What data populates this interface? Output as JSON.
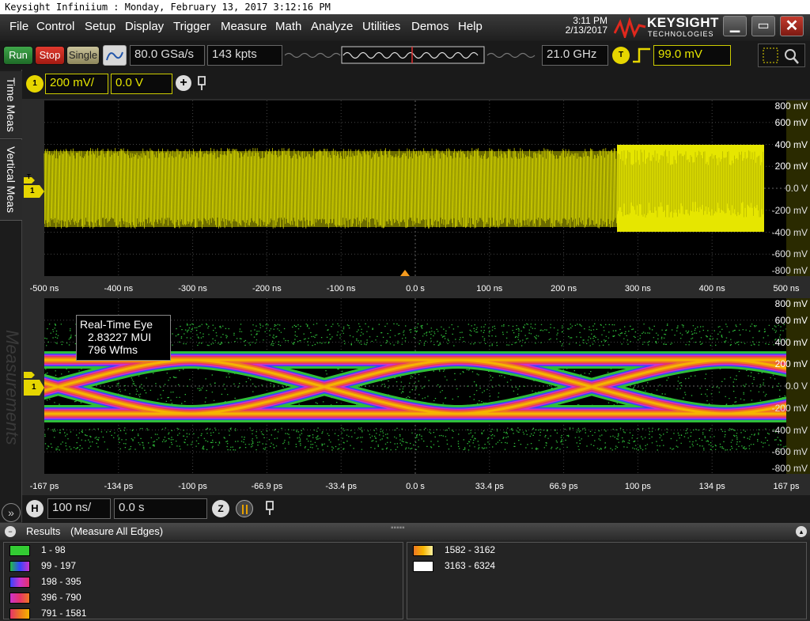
{
  "window": {
    "title": "Keysight Infiniium : Monday, February 13, 2017 3:12:16 PM"
  },
  "menu": [
    "File",
    "Control",
    "Setup",
    "Display",
    "Trigger",
    "Measure",
    "Math",
    "Analyze",
    "Utilities",
    "Demos",
    "Help"
  ],
  "clock": {
    "time": "3:11 PM",
    "date": "2/13/2017"
  },
  "brand": {
    "name": "KEYSIGHT",
    "sub": "TECHNOLOGIES"
  },
  "toolbar": {
    "run": "Run",
    "stop": "Stop",
    "single": "Single",
    "sample_rate": "80.0 GSa/s",
    "memory_depth": "143 kpts",
    "bandwidth": "21.0 GHz",
    "trigger_label": "T",
    "trigger_level": "99.0 mV"
  },
  "sidebar": {
    "tab1": "Time Meas",
    "tab2": "Vertical Meas",
    "tab3": "Measurements"
  },
  "channel": {
    "label": "1",
    "scale": "200 mV/",
    "offset": "0.0 V",
    "marker": "1"
  },
  "timebase": {
    "label": "H",
    "scale": "100 ns/",
    "position": "0.0 s"
  },
  "upper_plot": {
    "y_ticks": [
      "800 mV",
      "600 mV",
      "400 mV",
      "200 mV",
      "0.0 V",
      "-200 mV",
      "-400 mV",
      "-600 mV",
      "-800 mV"
    ],
    "x_ticks": [
      "-500 ns",
      "-400 ns",
      "-300 ns",
      "-200 ns",
      "-100 ns",
      "0.0 s",
      "100 ns",
      "200 ns",
      "300 ns",
      "400 ns",
      "500 ns"
    ],
    "trace_color": "#e6e600",
    "channel_marker": "1"
  },
  "eye_plot": {
    "y_ticks": [
      "800 mV",
      "600 mV",
      "400 mV",
      "200 mV",
      "0.0 V",
      "-200 mV",
      "-400 mV",
      "-600 mV",
      "-800 mV"
    ],
    "x_ticks": [
      "-167 ps",
      "-134 ps",
      "-100 ps",
      "-66.9 ps",
      "-33.4 ps",
      "0.0 s",
      "33.4 ps",
      "66.9 ps",
      "100 ps",
      "134 ps",
      "167 ps"
    ],
    "tooltip": {
      "title": "Real-Time Eye",
      "mui": "2.83227 MUI",
      "wfms": "796 Wfms"
    },
    "watermark": "Measurements",
    "channel_marker": "1"
  },
  "results": {
    "title": "Results",
    "subtitle": "(Measure All Edges)",
    "legend": [
      {
        "range": "1 - 98",
        "color": "#33cc33"
      },
      {
        "range": "99 - 197",
        "color": "#3344ff"
      },
      {
        "range": "198 - 395",
        "color": "#cc33cc"
      },
      {
        "range": "396 - 790",
        "color": "#e6336a"
      },
      {
        "range": "791 - 1581",
        "color": "#ee7722"
      },
      {
        "range": "1582 - 3162",
        "color": "#f5b400"
      },
      {
        "range": "3163 - 6324",
        "color": "#ffffff"
      }
    ]
  }
}
